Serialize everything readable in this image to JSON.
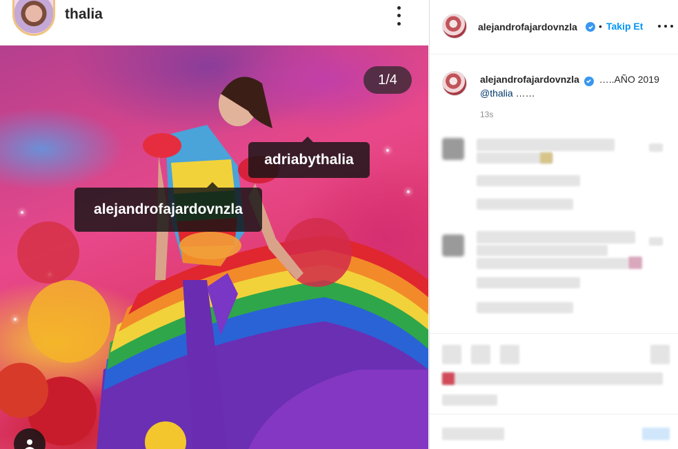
{
  "post": {
    "author": "thalia",
    "counter": "1/4",
    "tags": [
      "adriabythalia",
      "alejandrofajardovnzla"
    ]
  },
  "sidebar": {
    "username": "alejandrofajardovnzla",
    "separator": "•",
    "follow_label": "Takip Et",
    "caption_username": "alejandrofajardovnzla",
    "caption_text": "…..AÑO 2019",
    "mention": "@thalia",
    "mention_suffix": " ……",
    "timestamp": "13s"
  },
  "colors": {
    "accent": "#0095f6",
    "verified": "#3897f0",
    "text": "#262626",
    "muted": "#8e8e8e"
  },
  "icons": [
    "more-vertical-icon",
    "verified-badge-icon",
    "more-horizontal-icon",
    "user-tag-icon"
  ]
}
